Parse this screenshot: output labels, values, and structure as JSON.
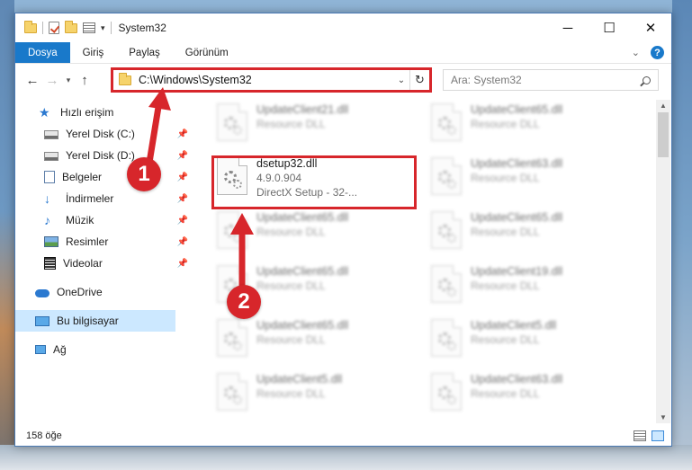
{
  "window": {
    "title": "System32",
    "controls": {
      "minimize": "─",
      "maximize": "☐",
      "close": "✕"
    }
  },
  "ribbon": {
    "tabs": [
      "Dosya",
      "Giriş",
      "Paylaş",
      "Görünüm"
    ],
    "help": "?"
  },
  "navigation": {
    "address": "C:\\Windows\\System32",
    "search_placeholder": "Ara: System32"
  },
  "nav_pane": {
    "items": [
      {
        "label": "Hızlı erişim",
        "icon": "star-icon",
        "pinned": false
      },
      {
        "label": "Yerel Disk (C:)",
        "icon": "drive-icon",
        "pinned": true
      },
      {
        "label": "Yerel Disk (D:)",
        "icon": "drive-icon",
        "pinned": true
      },
      {
        "label": "Belgeler",
        "icon": "documents-icon",
        "pinned": true
      },
      {
        "label": "İndirmeler",
        "icon": "downloads-icon",
        "pinned": true
      },
      {
        "label": "Müzik",
        "icon": "music-icon",
        "pinned": true
      },
      {
        "label": "Resimler",
        "icon": "pictures-icon",
        "pinned": true
      },
      {
        "label": "Videolar",
        "icon": "videos-icon",
        "pinned": true
      },
      {
        "label": "OneDrive",
        "icon": "cloud-icon",
        "pinned": false
      },
      {
        "label": "Bu bilgisayar",
        "icon": "computer-icon",
        "pinned": false,
        "selected": true
      },
      {
        "label": "Ağ",
        "icon": "network-icon",
        "pinned": false
      }
    ]
  },
  "files": {
    "highlighted": {
      "name": "dsetup32.dll",
      "version": "4.9.0.904",
      "description": "DirectX Setup - 32-..."
    },
    "background_tiles": [
      {
        "name": "UpdateClient21.dll",
        "type": "Resource DLL"
      },
      {
        "name": "UpdateClient65.dll",
        "type": "Resource DLL"
      },
      {
        "name": "UpdateClient63.dll",
        "type": "Resource DLL"
      },
      {
        "name": "UpdateClient65.dll",
        "type": "Resource DLL"
      },
      {
        "name": "UpdateClient65.dll",
        "type": "Resource DLL"
      },
      {
        "name": "UpdateClient65.dll",
        "type": "Resource DLL"
      },
      {
        "name": "UpdateClient19.dll",
        "type": "Resource DLL"
      },
      {
        "name": "UpdateClient65.dll",
        "type": "Resource DLL"
      },
      {
        "name": "UpdateClient5.dll",
        "type": "Resource DLL"
      },
      {
        "name": "UpdateClient5.dll",
        "type": "Resource DLL"
      },
      {
        "name": "UpdateClient63.dll",
        "type": "Resource DLL"
      }
    ]
  },
  "annotations": {
    "step1": "1",
    "step2": "2",
    "highlight_color": "#d7262b"
  },
  "status": {
    "item_count": "158 öğe"
  }
}
